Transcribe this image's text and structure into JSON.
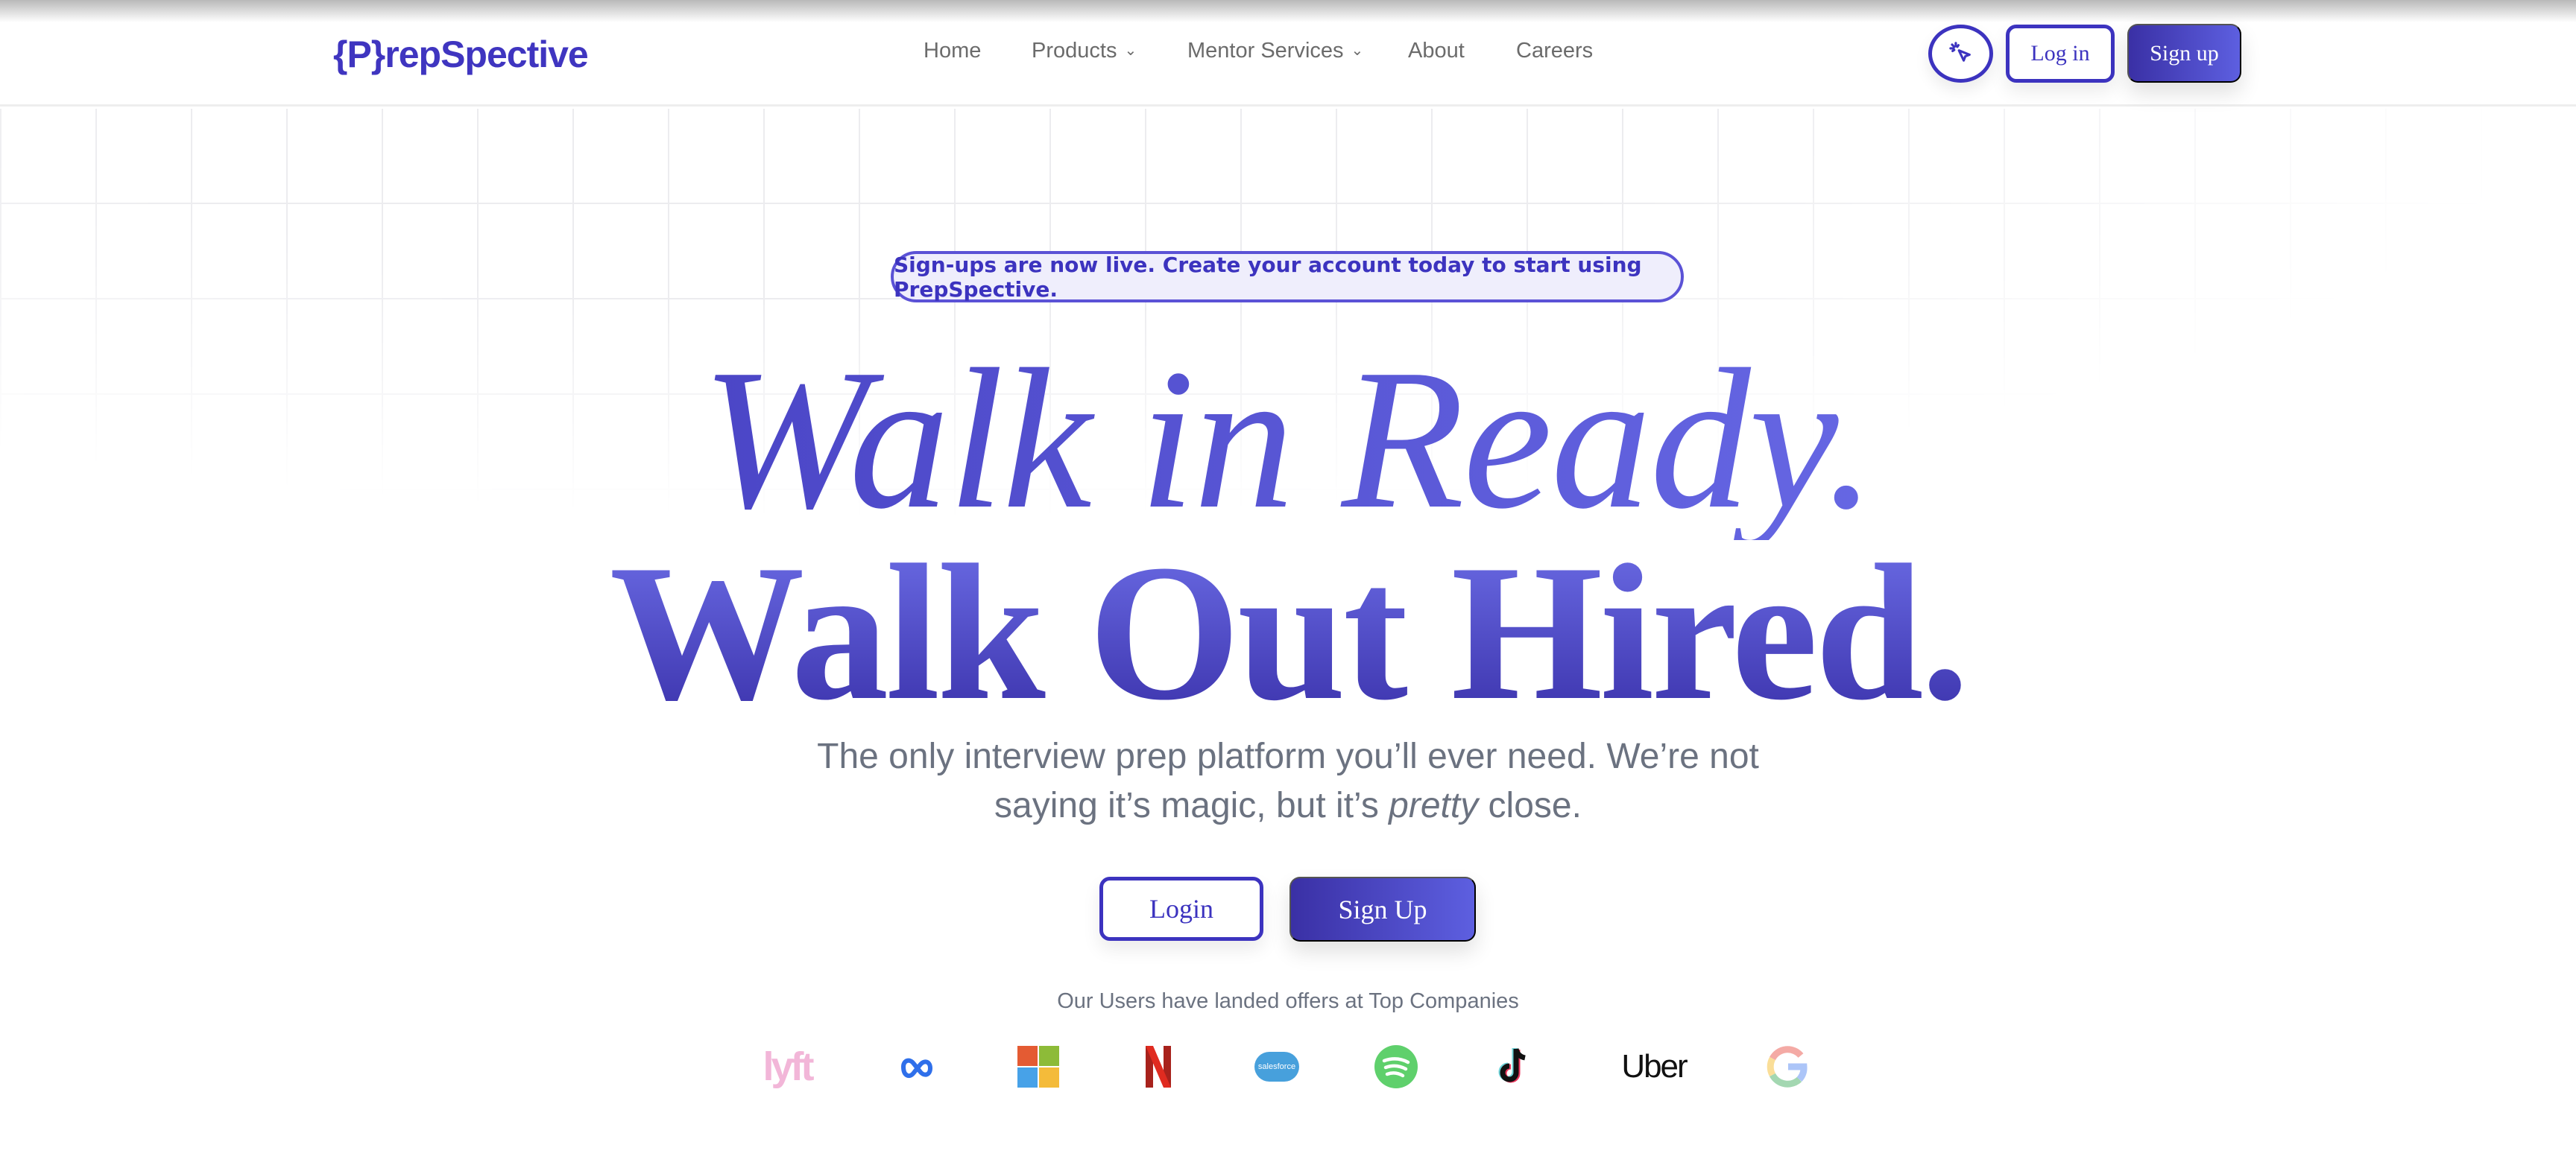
{
  "header": {
    "logo": "{P}repSpective",
    "nav": [
      {
        "label": "Home"
      },
      {
        "label": "Products",
        "dropdown": true
      },
      {
        "label": "Mentor Services",
        "dropdown": true
      },
      {
        "label": "About"
      },
      {
        "label": "Careers"
      }
    ],
    "cursor_icon": "cursor-click-icon",
    "login": "Log in",
    "signup": "Sign up"
  },
  "hero": {
    "banner": "Sign-ups are now live. Create your account today to start using PrepSpective.",
    "title_line1": "Walk in Ready.",
    "title_line2": "Walk Out Hired.",
    "subtitle_part1": "The only interview prep platform you’ll ever need. We’re not",
    "subtitle_part2": "saying it’s magic, but it’s ",
    "subtitle_em": "pretty",
    "subtitle_part3": " close.",
    "login": "Login",
    "signup": "Sign Up"
  },
  "companies": {
    "caption": "Our Users have landed offers at Top Companies",
    "logos": [
      "lyft",
      "meta",
      "microsoft",
      "netflix",
      "salesforce",
      "spotify",
      "tiktok",
      "Uber",
      "google"
    ],
    "salesforce_text": "salesforce",
    "uber_text": "Uber",
    "lyft_text": "lyft"
  },
  "colors": {
    "brand": "#3c33bf",
    "text_muted": "#6b7280"
  }
}
